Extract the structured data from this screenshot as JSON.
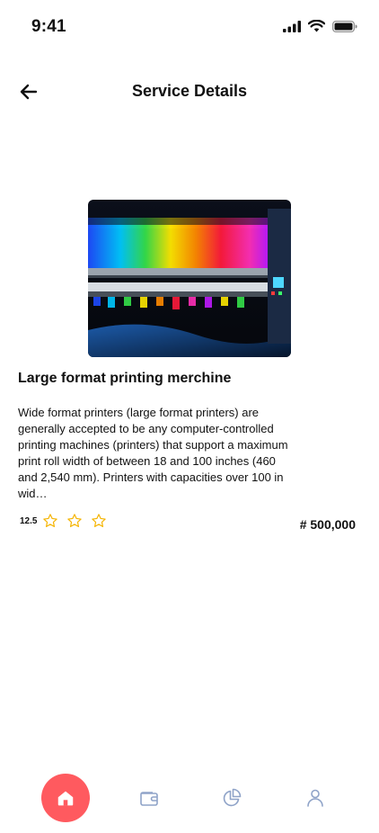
{
  "status": {
    "time": "9:41"
  },
  "header": {
    "title": "Service Details"
  },
  "service": {
    "name": "Large format printing merchine",
    "description": "Wide format printers (large format printers) are generally accepted to be any computer-controlled printing machines (printers) that support a maximum print roll width of between 18 and 100 inches (460 and 2,540 mm). Printers with capacities over 100 in wid…",
    "rating": "12.5",
    "stars": 3,
    "price": "# 500,000"
  },
  "nav": [
    "home-icon",
    "wallet-icon",
    "chart-icon",
    "profile-icon"
  ],
  "colors": {
    "accent": "#ff5a5f",
    "star": "#f5b400",
    "nav_icon": "#8fa3c8"
  }
}
